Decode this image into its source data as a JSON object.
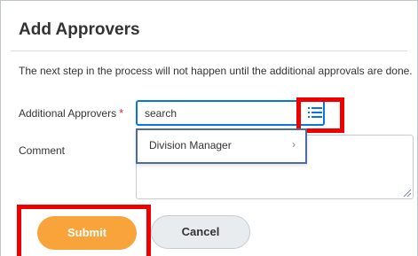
{
  "dialog": {
    "title": "Add Approvers",
    "notice": "The next step in the process will not happen until the additional approvals are done."
  },
  "form": {
    "approvers_label": "Additional Approvers",
    "required_marker": "*",
    "approvers_input_value": "search",
    "prompt_icon": "list-prompt-icon",
    "comment_label": "Comment",
    "comment_value": ""
  },
  "dropdown": {
    "items": [
      {
        "label": "Division Manager",
        "chevron": "›"
      }
    ]
  },
  "actions": {
    "submit_label": "Submit",
    "cancel_label": "Cancel"
  },
  "colors": {
    "accent_blue": "#0875e1",
    "submit_orange": "#f8a43a",
    "highlight_red": "#ee0000",
    "required_red": "#de2b2b"
  }
}
